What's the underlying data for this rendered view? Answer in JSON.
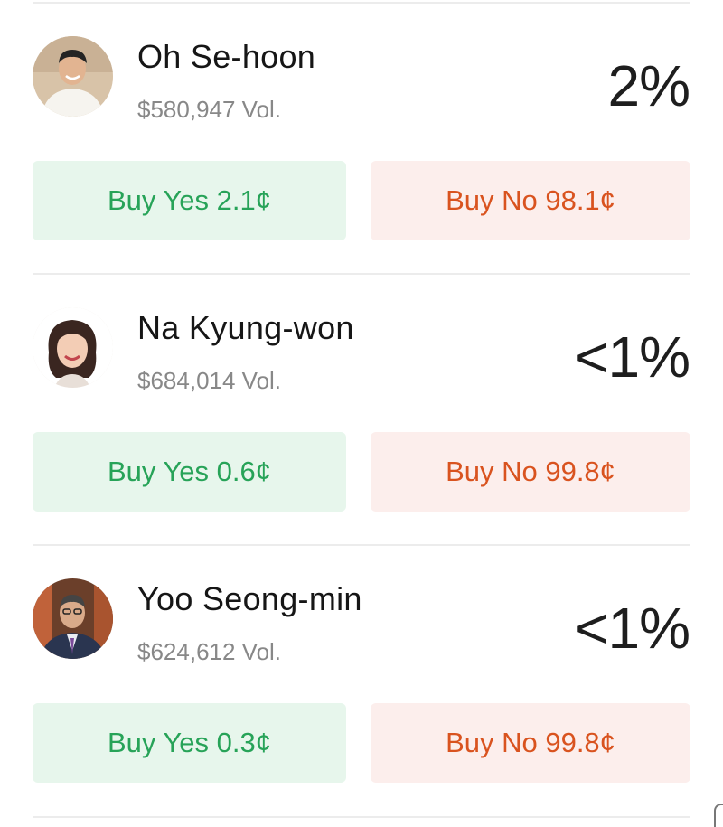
{
  "candidates": [
    {
      "name": "Oh Se-hoon",
      "volume": "$580,947 Vol.",
      "probability": "2%",
      "buy_yes": "Buy Yes 2.1¢",
      "buy_no": "Buy No 98.1¢"
    },
    {
      "name": "Na Kyung-won",
      "volume": "$684,014 Vol.",
      "probability": "<1%",
      "buy_yes": "Buy Yes 0.6¢",
      "buy_no": "Buy No 99.8¢"
    },
    {
      "name": "Yoo Seong-min",
      "volume": "$624,612 Vol.",
      "probability": "<1%",
      "buy_yes": "Buy Yes 0.3¢",
      "buy_no": "Buy No 99.8¢"
    }
  ],
  "colors": {
    "yes_bg": "#e7f6ec",
    "yes_text": "#27a358",
    "no_bg": "#fceeec",
    "no_text": "#d9531f",
    "divider": "#ececec"
  }
}
